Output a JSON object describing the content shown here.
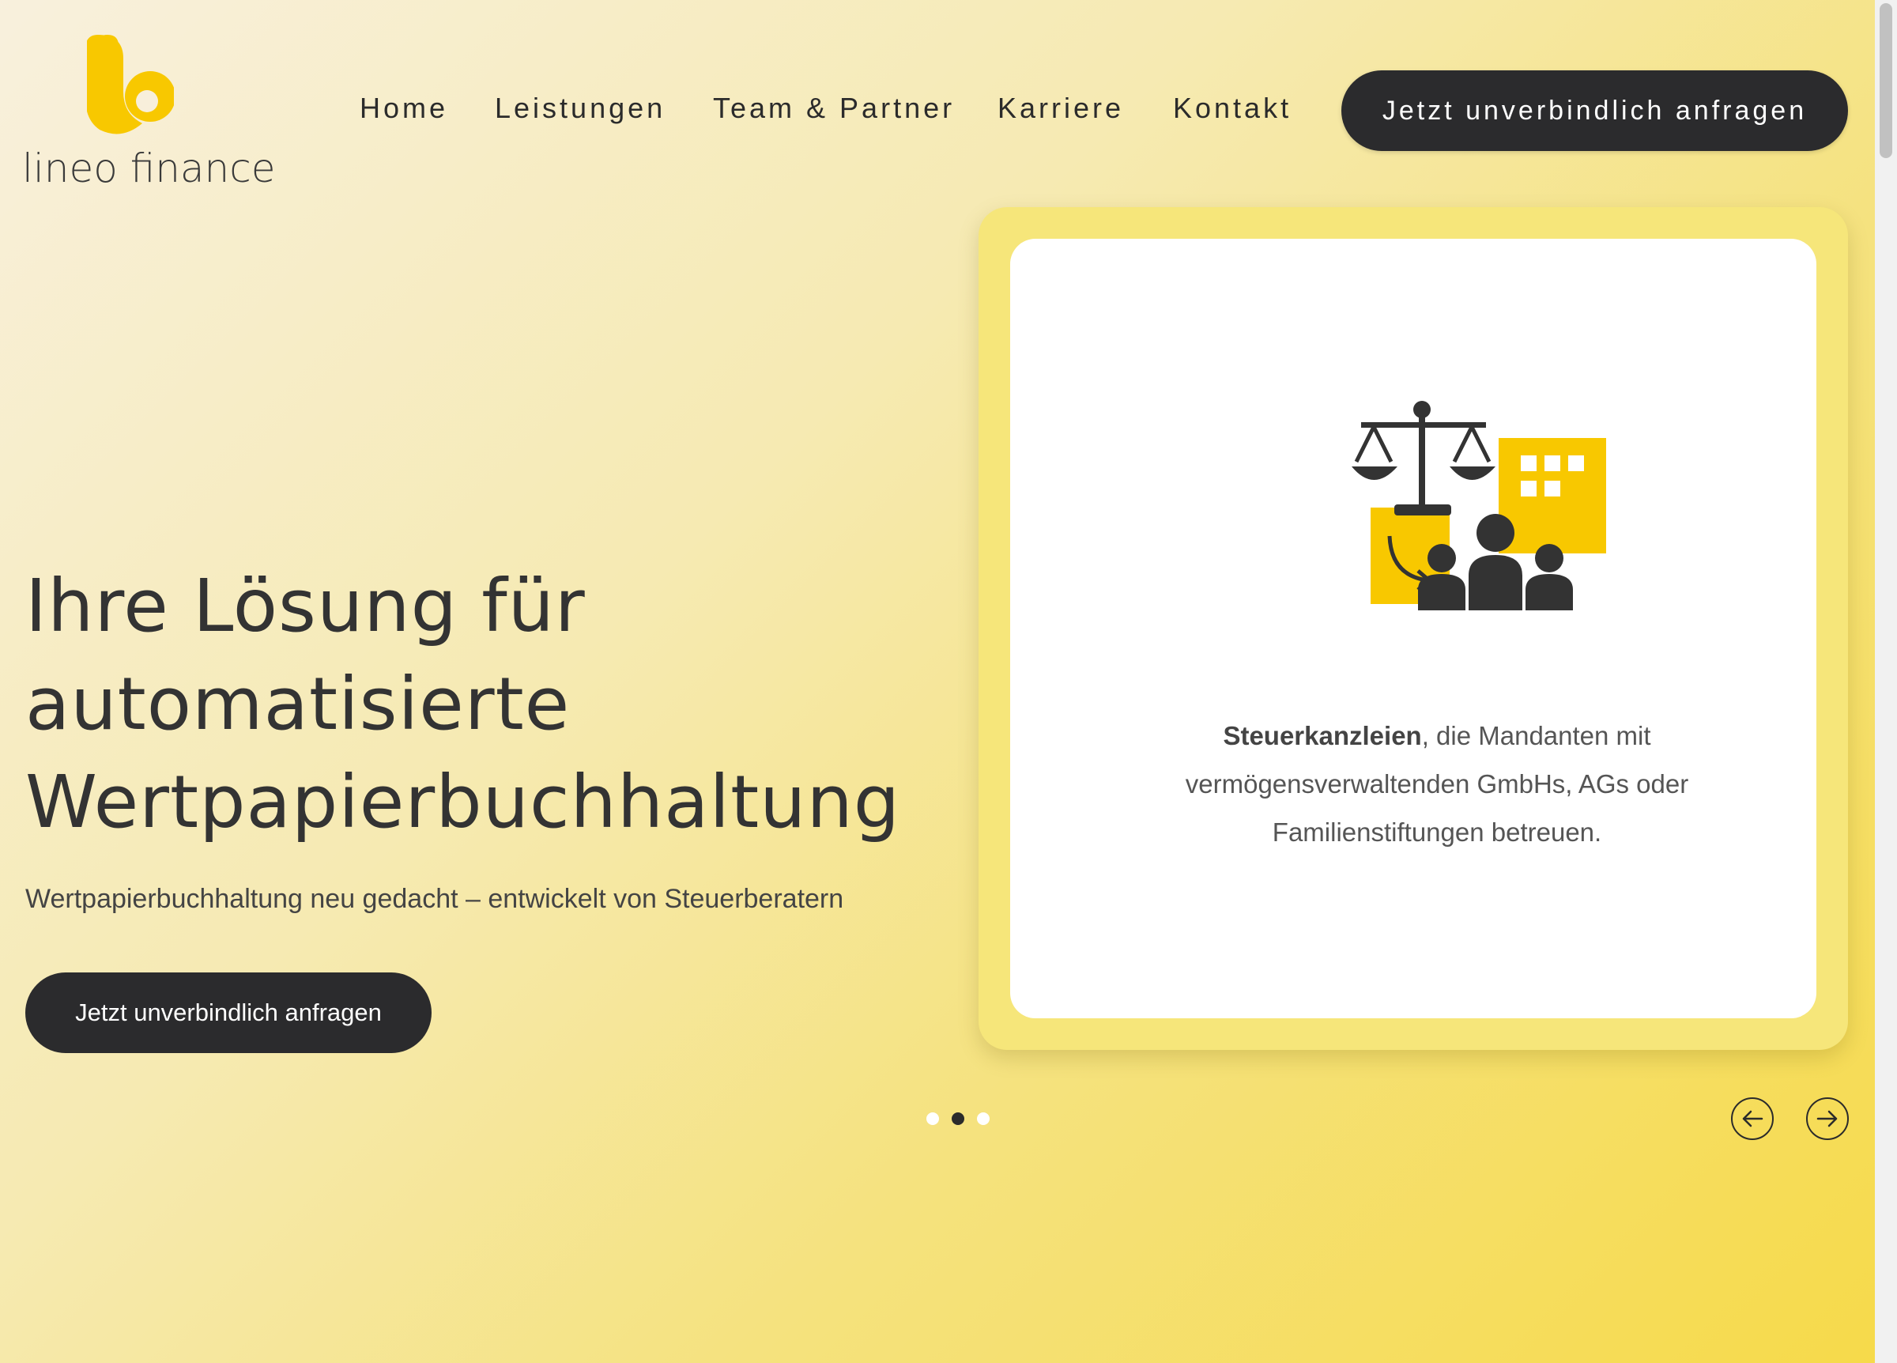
{
  "brand": {
    "name": "lineo finance",
    "logo_icon": "lineo-logo-icon",
    "accent_color": "#f8c800"
  },
  "nav": {
    "items": [
      {
        "label": "Home"
      },
      {
        "label": "Leistungen"
      },
      {
        "label": "Team & Partner"
      },
      {
        "label": "Karriere"
      },
      {
        "label": "Kontakt"
      }
    ],
    "cta_label": "Jetzt unverbindlich anfragen"
  },
  "hero": {
    "title_lines": [
      "Ihre Lösung für",
      "automatisierte",
      "Wertpapierbuchhaltung"
    ],
    "subtitle": "Wertpapierbuchhaltung neu gedacht – entwickelt von Steuerberatern",
    "cta_label": "Jetzt unverbindlich anfragen"
  },
  "slider": {
    "slide": {
      "illustration": "tax-office-scales-icon",
      "text_bold": "Steuerkanzleien",
      "text_rest": ", die Mandanten mit vermögensverwaltenden GmbHs, AGs oder Familienstiftungen betreuen."
    },
    "dots_count": 3,
    "active_index": 1,
    "prev_icon": "arrow-left-icon",
    "next_icon": "arrow-right-icon"
  },
  "colors": {
    "dark_button": "#2b2b2d",
    "card_frame": "#f6e67a",
    "text_dark": "#333333"
  }
}
